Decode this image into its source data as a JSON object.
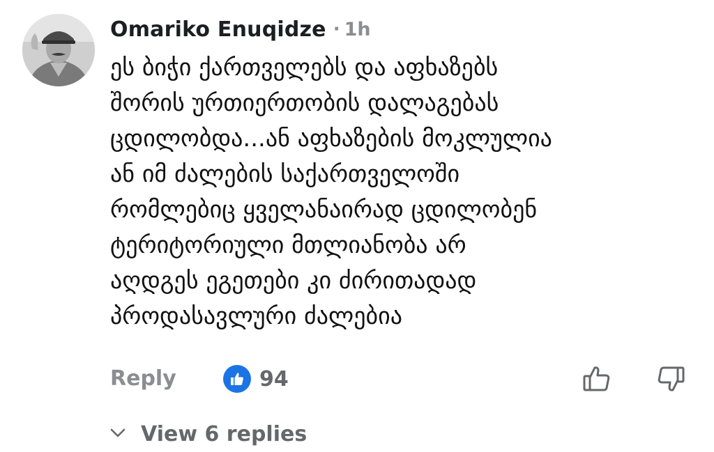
{
  "comment": {
    "author": "Omariko Enuqidze",
    "separator": "·",
    "time": "1h",
    "avatar_icon": "user-avatar-photo",
    "body_lines": [
      "ეს ბიჭი ქართველებს და აფხაზებს",
      "შორის ურთიერთობის დალაგებას",
      "ცდილობდა...ან აფხაზების მოკლულია",
      "ან იმ ძალების საქართველოში",
      "რომლებიც ყველანაირად ცდილობენ",
      "ტერიტორიული მთლიანობა არ",
      "აღდგეს ეგეთები კი ძირითადად",
      "პროდასავლური ძალებია"
    ]
  },
  "actions": {
    "reply_label": "Reply",
    "reaction_icon": "like-reaction-icon",
    "reaction_count": "94",
    "upvote_icon": "thumbs-up-icon",
    "downvote_icon": "thumbs-down-icon"
  },
  "replies": {
    "label": "View 6 replies",
    "icon": "chevron-down-icon"
  },
  "colors": {
    "text_primary": "#1c1e21",
    "text_secondary": "#8a8d91",
    "accent": "#1b74e4",
    "background": "#ffffff"
  }
}
